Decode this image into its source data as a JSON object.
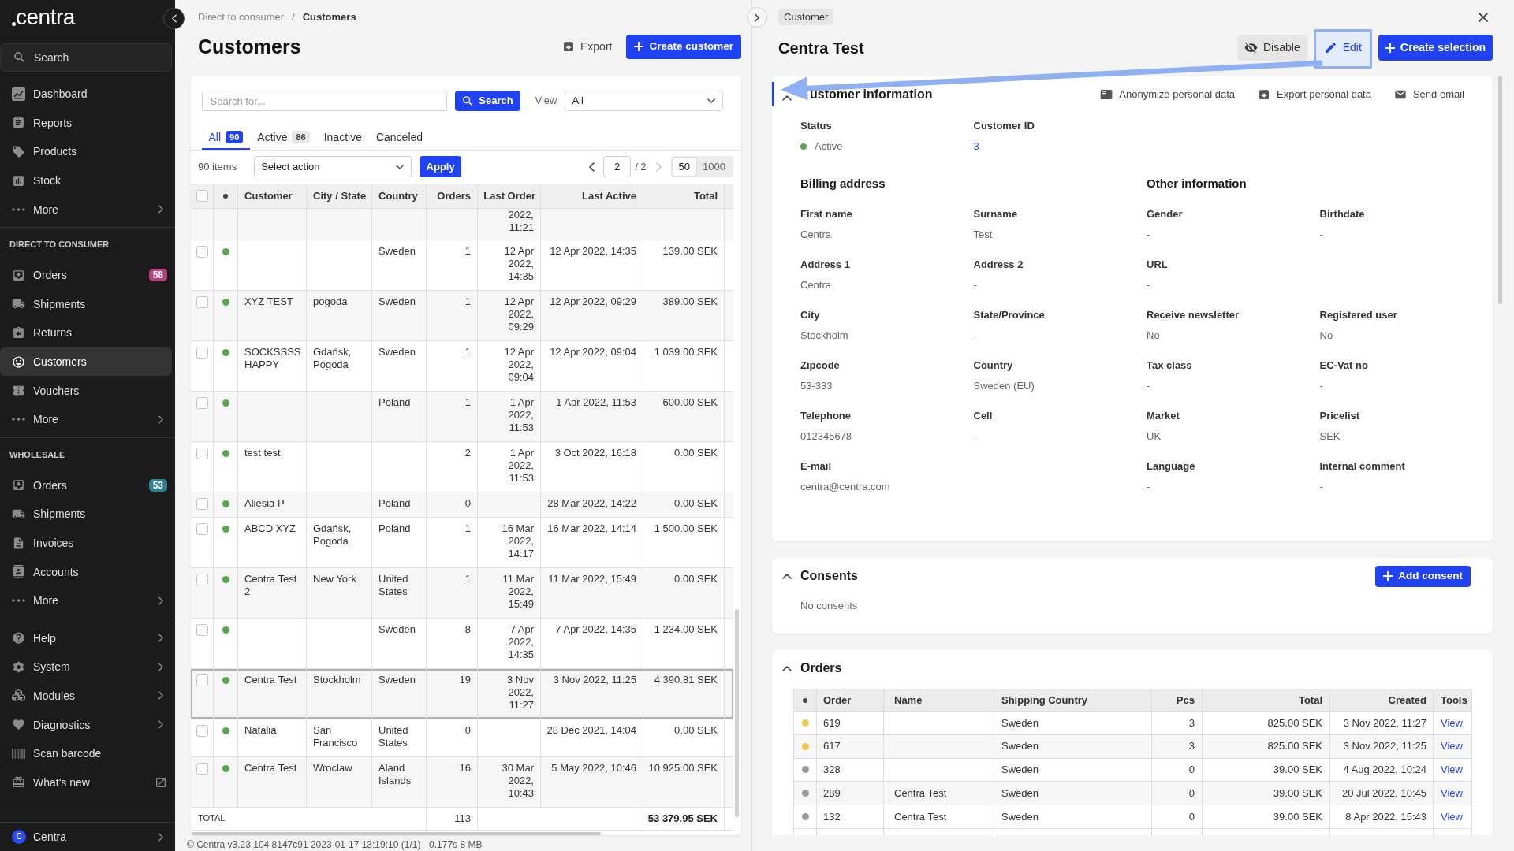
{
  "sidebar": {
    "logo": "centra",
    "search": {
      "placeholder": "Search"
    },
    "groups": [
      {
        "items": [
          {
            "label": "Dashboard",
            "kind": "link",
            "selected": false
          },
          {
            "label": "Reports",
            "kind": "link",
            "selected": false
          },
          {
            "label": "Products",
            "kind": "link",
            "selected": false
          },
          {
            "label": "Stock",
            "kind": "link",
            "selected": false
          },
          {
            "label": "More",
            "kind": "submenu",
            "selected": false
          }
        ]
      },
      {
        "heading": "DIRECT TO CONSUMER",
        "items": [
          {
            "label": "Orders",
            "kind": "link",
            "selected": false,
            "badge": {
              "text": "58",
              "color": "#b5417d"
            }
          },
          {
            "label": "Shipments",
            "kind": "link",
            "selected": false
          },
          {
            "label": "Returns",
            "kind": "link",
            "selected": false
          },
          {
            "label": "Customers",
            "kind": "link",
            "selected": true
          },
          {
            "label": "Vouchers",
            "kind": "link",
            "selected": false
          },
          {
            "label": "More",
            "kind": "submenu",
            "selected": false
          }
        ]
      },
      {
        "heading": "WHOLESALE",
        "items": [
          {
            "label": "Orders",
            "kind": "link",
            "selected": false,
            "badge": {
              "text": "53",
              "color": "#2f7f91"
            }
          },
          {
            "label": "Shipments",
            "kind": "link",
            "selected": false
          },
          {
            "label": "Invoices",
            "kind": "link",
            "selected": false
          },
          {
            "label": "Accounts",
            "kind": "link",
            "selected": false
          },
          {
            "label": "More",
            "kind": "submenu",
            "selected": false
          }
        ]
      },
      {
        "items": [
          {
            "label": "Help",
            "kind": "submenu",
            "selected": false
          },
          {
            "label": "System",
            "kind": "submenu",
            "selected": false
          },
          {
            "label": "Modules",
            "kind": "submenu",
            "selected": false
          },
          {
            "label": "Diagnostics",
            "kind": "submenu",
            "selected": false
          },
          {
            "label": "Scan barcode",
            "kind": "link",
            "selected": false
          },
          {
            "label": "What's new",
            "kind": "external",
            "selected": false
          }
        ]
      }
    ],
    "account": {
      "initial": "C",
      "name": "Centra",
      "kind": "submenu"
    }
  },
  "breadcrumb": {
    "items": [
      "Direct to consumer",
      "Customers"
    ],
    "separator": "/"
  },
  "header": {
    "title": "Customers",
    "actions": [
      {
        "label": "Export",
        "kind": "plain"
      },
      {
        "label": "Create customer",
        "kind": "primary"
      }
    ]
  },
  "filters": {
    "search": {
      "placeholder": "Search for..."
    },
    "search_button": "Search",
    "view": {
      "label": "View",
      "value": "All"
    }
  },
  "tabs": [
    {
      "label": "All",
      "count": "90",
      "selected": true
    },
    {
      "label": "Active",
      "count": "86",
      "selected": false
    },
    {
      "label": "Inactive",
      "selected": false
    },
    {
      "label": "Canceled",
      "selected": false
    }
  ],
  "toolbar": {
    "count": "90 items",
    "action": {
      "value": "Select action"
    },
    "apply": "Apply",
    "pagination": {
      "prev": {
        "disabled": false
      },
      "page": "2",
      "of": "/ 2",
      "next": {
        "disabled": true
      }
    },
    "page_sizes": [
      {
        "label": "50",
        "selected": true
      },
      {
        "label": "1000",
        "selected": false
      }
    ]
  },
  "table": {
    "header_checkbox": {
      "checked": false
    },
    "columns": [
      "Customer",
      "City / State",
      "Country",
      "Orders",
      "Last Order",
      "Last Active",
      "Total"
    ],
    "cut_row": {
      "last_order": "2022, 11:21"
    },
    "rows": [
      {
        "checked": false,
        "color": "#5ba452",
        "country": "Sweden",
        "orders": "1",
        "last_order": "12 Apr 2022, 14:35",
        "last_active": "12 Apr 2022, 14:35",
        "total": "139.00 SEK",
        "selected": false
      },
      {
        "checked": false,
        "color": "#5ba452",
        "customer": "XYZ TEST",
        "city_state": "pogoda",
        "country": "Sweden",
        "orders": "1",
        "last_order": "12 Apr 2022, 09:29",
        "last_active": "12 Apr 2022, 09:29",
        "total": "389.00 SEK",
        "selected": false
      },
      {
        "checked": false,
        "color": "#5ba452",
        "customer": "SOCKSSSS HAPPY",
        "city_state": "Gdańsk, Pogoda",
        "country": "Sweden",
        "orders": "1",
        "last_order": "12 Apr 2022, 09:04",
        "last_active": "12 Apr 2022, 09:04",
        "total": "1 039.00 SEK",
        "selected": false
      },
      {
        "checked": false,
        "color": "#5ba452",
        "country": "Poland",
        "orders": "1",
        "last_order": "1 Apr 2022, 11:53",
        "last_active": "1 Apr 2022, 11:53",
        "total": "600.00 SEK",
        "selected": false
      },
      {
        "checked": false,
        "color": "#5ba452",
        "customer": "test test",
        "orders": "2",
        "last_order": "1 Apr 2022, 11:53",
        "last_active": "3 Oct 2022, 16:18",
        "total": "0.00 SEK",
        "selected": false
      },
      {
        "checked": false,
        "color": "#5ba452",
        "customer": "Aliesia P",
        "country": "Poland",
        "orders": "0",
        "last_active": "28 Mar 2022, 14:22",
        "total": "0.00 SEK",
        "selected": false
      },
      {
        "checked": false,
        "color": "#5ba452",
        "customer": "ABCD XYZ",
        "city_state": "Gdańsk, Pogoda",
        "country": "Poland",
        "orders": "1",
        "last_order": "16 Mar 2022, 14:17",
        "last_active": "16 Mar 2022, 14:14",
        "total": "1 500.00 SEK",
        "selected": false
      },
      {
        "checked": false,
        "color": "#5ba452",
        "customer": "Centra Test 2",
        "city_state": "New York",
        "country": "United States",
        "orders": "1",
        "last_order": "11 Mar 2022, 15:49",
        "last_active": "11 Mar 2022, 15:49",
        "total": "0.00 SEK",
        "selected": false
      },
      {
        "checked": false,
        "color": "#5ba452",
        "country": "Sweden",
        "orders": "8",
        "last_order": "7 Apr 2022, 14:35",
        "last_active": "7 Apr 2022, 14:35",
        "total": "1 234.00 SEK",
        "selected": false
      },
      {
        "checked": false,
        "color": "#5ba452",
        "customer": "Centra Test",
        "city_state": "Stockholm",
        "country": "Sweden",
        "orders": "19",
        "last_order": "3 Nov 2022, 11:27",
        "last_active": "3 Nov 2022, 11:25",
        "total": "4 390.81 SEK",
        "selected": true
      },
      {
        "checked": false,
        "color": "#5ba452",
        "customer": "Natalia",
        "city_state": "San Francisco",
        "country": "United States",
        "orders": "0",
        "last_active": "28 Dec 2021, 14:04",
        "total": "0.00 SEK",
        "selected": false
      },
      {
        "checked": false,
        "color": "#5ba452",
        "customer": "Centra Test",
        "city_state": "Wroclaw",
        "country": "Aland Islands",
        "orders": "16",
        "last_order": "30 Mar 2022, 10:43",
        "last_active": "5 May 2022, 10:46",
        "total": "10 925.00 SEK",
        "selected": false
      }
    ],
    "total": {
      "label": "TOTAL",
      "orders": "113",
      "total": "53 379.95 SEK"
    }
  },
  "footer": "© Centra v3.23.104 8147c91 2023-01-17 13:19:10 (1/1) - 0.177s 8 MB",
  "detail": {
    "tag": "Customer",
    "title": "Centra Test",
    "actions": [
      {
        "label": "Disable",
        "kind": "secondary",
        "highlighted": false
      },
      {
        "label": "Edit",
        "kind": "ghost",
        "highlighted": true
      },
      {
        "label": "Create selection",
        "kind": "primary",
        "highlighted": false
      }
    ],
    "customer_info": {
      "title": "ustomer information",
      "expanded": true,
      "active": true,
      "actions": [
        {
          "label": "Anonymize personal data"
        },
        {
          "label": "Export personal data"
        },
        {
          "label": "Send email"
        }
      ],
      "status": {
        "label": "Status",
        "value": "Active",
        "color": "#5ba452"
      },
      "customer_id": {
        "label": "Customer ID",
        "value": "3"
      },
      "sections": [
        {
          "title": "Billing address",
          "rows": [
            [
              {
                "label": "First name",
                "value": "Centra"
              },
              {
                "label": "Surname",
                "value": "Test"
              }
            ],
            [
              {
                "label": "Address 1",
                "value": "Centra"
              },
              {
                "label": "Address 2",
                "value": "-"
              }
            ],
            [
              {
                "label": "City",
                "value": "Stockholm"
              },
              {
                "label": "State/Province",
                "value": "-"
              }
            ],
            [
              {
                "label": "Zipcode",
                "value": "53-333"
              },
              {
                "label": "Country",
                "value": "Sweden (EU)"
              }
            ],
            [
              {
                "label": "Telephone",
                "value": "012345678"
              },
              {
                "label": "Cell",
                "value": "-"
              }
            ],
            [
              {
                "label": "E-mail",
                "value": "centra@centra.com"
              }
            ]
          ]
        },
        {
          "title": "Other information",
          "rows": [
            [
              {
                "label": "Gender",
                "value": "-"
              },
              {
                "label": "Birthdate",
                "value": "-"
              }
            ],
            [
              {
                "label": "URL",
                "value": "-"
              }
            ],
            [
              {
                "label": "Receive newsletter",
                "value": "No"
              },
              {
                "label": "Registered user",
                "value": "No"
              }
            ],
            [
              {
                "label": "Tax class",
                "value": "-"
              },
              {
                "label": "EC-Vat no",
                "value": "-"
              }
            ],
            [
              {
                "label": "Market",
                "value": "UK"
              },
              {
                "label": "Pricelist",
                "value": "SEK"
              }
            ],
            [
              {
                "label": "Language",
                "value": "-"
              },
              {
                "label": "Internal comment",
                "value": "-"
              }
            ]
          ]
        }
      ]
    },
    "consents": {
      "title": "Consents",
      "expanded": true,
      "active": false,
      "button": "Add consent",
      "empty": "No consents"
    },
    "orders": {
      "title": "Orders",
      "expanded": true,
      "active": false,
      "columns": [
        "Order",
        "Name",
        "Shipping Country",
        "Pcs",
        "Total",
        "Created",
        "Tools"
      ],
      "rows": [
        {
          "color": "#f3c84b",
          "order": "619",
          "shipping_country": "Sweden",
          "pcs": "3",
          "total": "825.00 SEK",
          "created": "3 Nov 2022, 11:27",
          "tool": "View"
        },
        {
          "color": "#f3c84b",
          "order": "617",
          "shipping_country": "Sweden",
          "pcs": "3",
          "total": "825.00 SEK",
          "created": "3 Nov 2022, 11:25",
          "tool": "View"
        },
        {
          "color": "#9b9b9b",
          "order": "328",
          "shipping_country": "Sweden",
          "pcs": "0",
          "total": "39.00 SEK",
          "created": "4 Aug 2022, 10:24",
          "tool": "View"
        },
        {
          "color": "#9b9b9b",
          "order": "289",
          "name": "Centra Test",
          "shipping_country": "Sweden",
          "pcs": "0",
          "total": "39.00 SEK",
          "created": "20 Jul 2022, 10:45",
          "tool": "View"
        },
        {
          "color": "#9b9b9b",
          "order": "132",
          "name": "Centra Test",
          "shipping_country": "Sweden",
          "pcs": "0",
          "total": "39.00 SEK",
          "created": "8 Apr 2022, 15:43",
          "tool": "View"
        }
      ]
    }
  }
}
